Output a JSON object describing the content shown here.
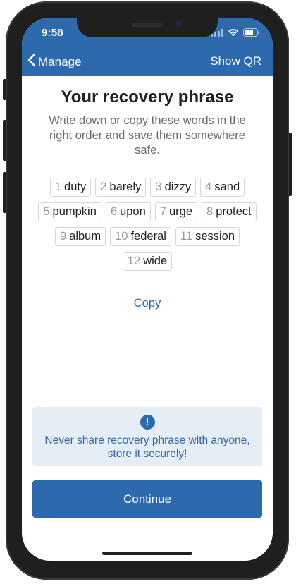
{
  "status_bar": {
    "time": "9:58"
  },
  "nav": {
    "back_label": "Manage",
    "right_label": "Show QR"
  },
  "main": {
    "title": "Your recovery phrase",
    "subtitle": "Write down or copy these words in the right order and save them somewhere safe.",
    "words": [
      {
        "num": "1",
        "word": "duty"
      },
      {
        "num": "2",
        "word": "barely"
      },
      {
        "num": "3",
        "word": "dizzy"
      },
      {
        "num": "4",
        "word": "sand"
      },
      {
        "num": "5",
        "word": "pumpkin"
      },
      {
        "num": "6",
        "word": "upon"
      },
      {
        "num": "7",
        "word": "urge"
      },
      {
        "num": "8",
        "word": "protect"
      },
      {
        "num": "9",
        "word": "album"
      },
      {
        "num": "10",
        "word": "federal"
      },
      {
        "num": "11",
        "word": "session"
      },
      {
        "num": "12",
        "word": "wide"
      }
    ],
    "copy_label": "Copy"
  },
  "warning": {
    "icon": "exclamation-icon",
    "icon_glyph": "!",
    "text": "Never share recovery phrase with anyone, store it securely!"
  },
  "footer": {
    "continue_label": "Continue"
  },
  "colors": {
    "accent": "#2c6aad",
    "warning_bg": "#e6eef5"
  }
}
